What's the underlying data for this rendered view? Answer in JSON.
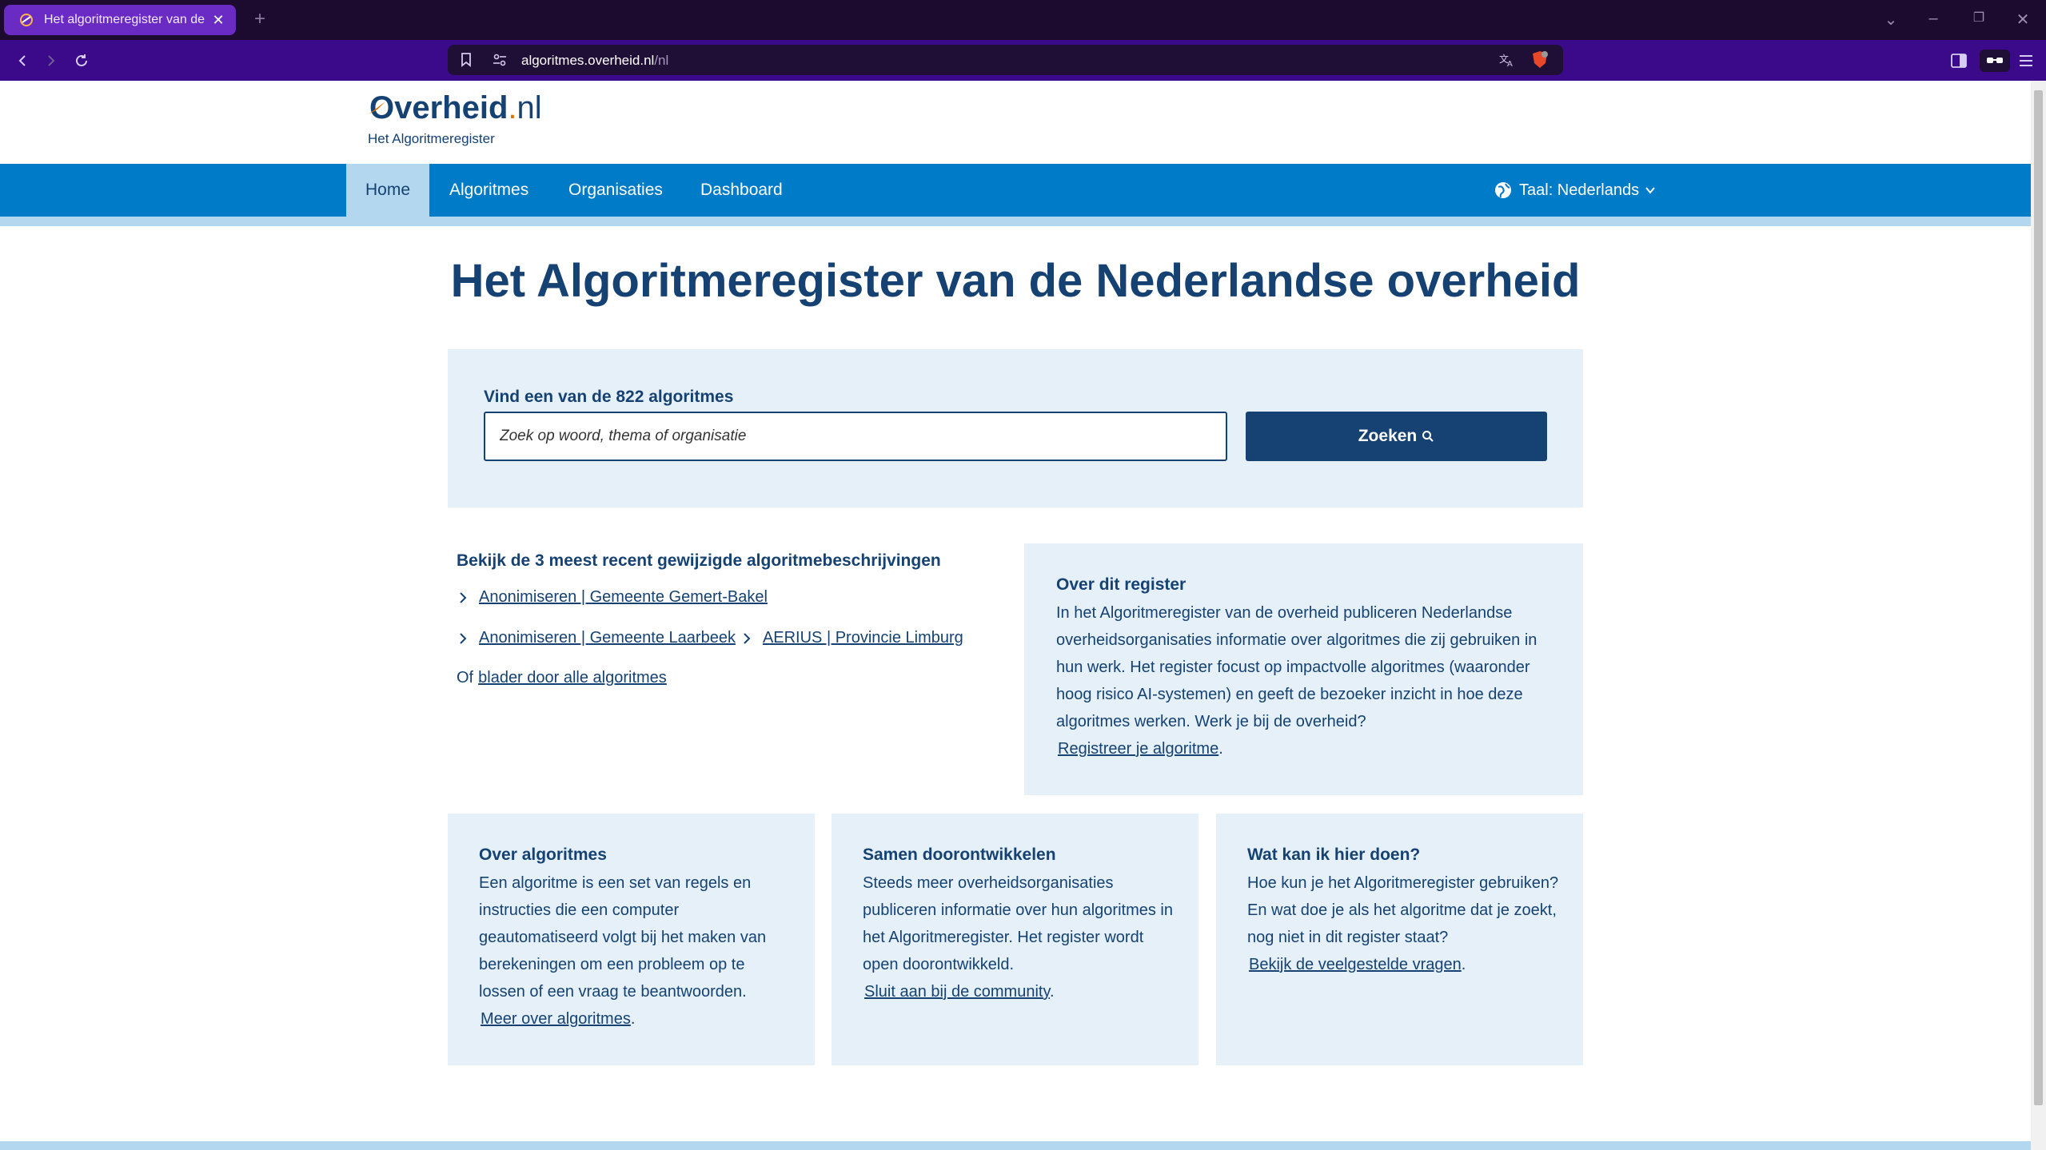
{
  "browser": {
    "tab_title": "Het algoritmeregister van de N",
    "url_domain": "algoritmes.overheid.nl",
    "url_path": "/nl"
  },
  "site": {
    "logo_text": "Overheid",
    "logo_dot": ".",
    "logo_tld": "nl",
    "logo_subtitle": "Het Algoritmeregister"
  },
  "nav": {
    "items": [
      "Home",
      "Algoritmes",
      "Organisaties",
      "Dashboard"
    ],
    "language": "Taal: Nederlands"
  },
  "main": {
    "title": "Het Algoritmeregister van de Nederlandse overheid",
    "search_label": "Vind een van de 822 algoritmes",
    "search_placeholder": "Zoek op woord, thema of organisatie",
    "search_button": "Zoeken"
  },
  "recent": {
    "title": "Bekijk de 3 meest recent gewijzigde algoritmebeschrijvingen",
    "links": [
      "Anonimiseren | Gemeente Gemert-Bakel",
      "Anonimiseren | Gemeente Laarbeek",
      "AERIUS | Provincie Limburg"
    ],
    "browse_prefix": "Of",
    "browse_link": "blader door alle algoritmes"
  },
  "about": {
    "title": "Over dit register",
    "text": "In het Algoritmeregister van de overheid publiceren Nederlandse overheidsorganisaties informatie over algoritmes die zij gebruiken in hun werk. Het register focust op impactvolle algoritmes (waaronder hoog risico AI-systemen) en geeft de bezoeker inzicht in hoe deze algoritmes werken. Werk je bij de overheid?",
    "link": "Registreer je algoritme",
    "suffix": "."
  },
  "cards": [
    {
      "title": "Over algoritmes",
      "text": "Een algoritme is een set van regels en instructies die een computer geautomatiseerd volgt bij het maken van berekeningen om een probleem op te lossen of een vraag te beantwoorden.",
      "link": "Meer over algoritmes",
      "suffix": "."
    },
    {
      "title": "Samen doorontwikkelen",
      "text": "Steeds meer overheidsorganisaties publiceren informatie over hun algoritmes in het Algoritmeregister. Het register wordt open doorontwikkeld.",
      "link": "Sluit aan bij de community",
      "suffix": "."
    },
    {
      "title": "Wat kan ik hier doen?",
      "text": "Hoe kun je het Algoritmeregister gebruiken? En wat doe je als het algoritme dat je zoekt, nog niet in dit register staat?",
      "link": "Bekijk de veelgestelde vragen",
      "suffix": "."
    }
  ],
  "icons": {
    "tab_favicon": "overheid-favicon-icon",
    "close": "close-icon",
    "back": "back-arrow-icon",
    "forward": "forward-arrow-icon",
    "reload": "reload-icon",
    "bookmark": "bookmark-icon",
    "site_settings": "site-settings-icon",
    "translate": "translate-icon",
    "brave_shield": "brave-shield-icon",
    "sidebar": "sidebar-icon",
    "wallet": "wallet-icon",
    "menu": "menu-icon",
    "globe": "globe-icon",
    "search": "search-icon",
    "chevron": "chevron-right-icon"
  },
  "colors": {
    "brand_dark": "#154273",
    "brand_blue": "#007bc7",
    "panel_bg": "#e5f0f9",
    "nav_active_bg": "#b2d7ee",
    "browser_tab_active": "#6a2bc4",
    "browser_toolbar": "#3a0a8a"
  }
}
